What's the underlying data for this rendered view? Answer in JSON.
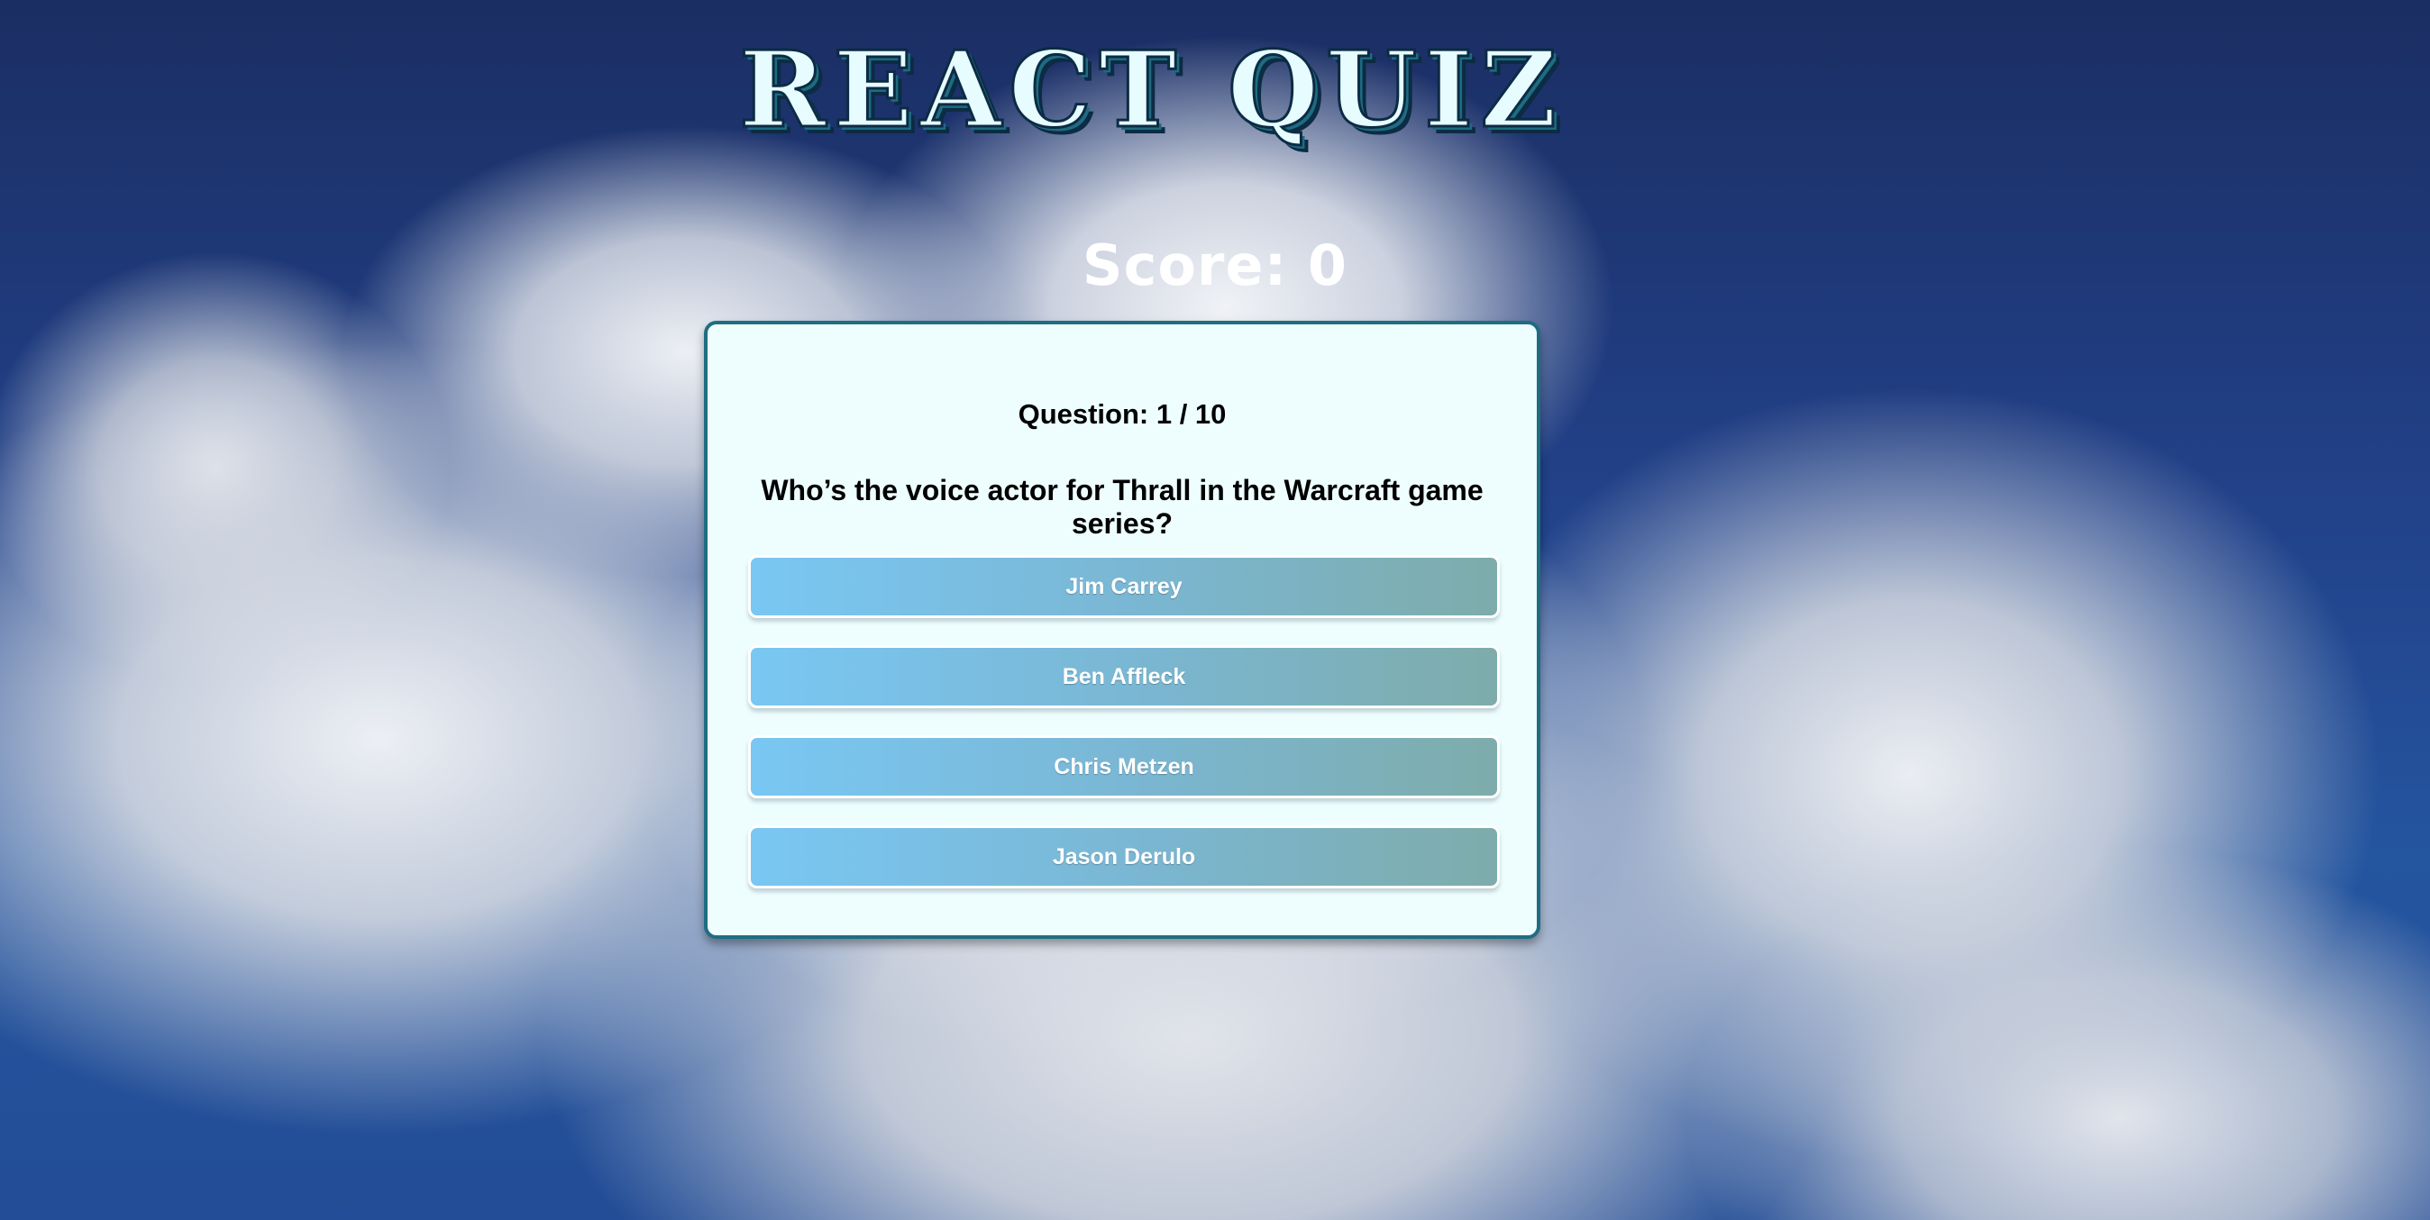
{
  "header": {
    "title": "REACT QUIZ"
  },
  "score": {
    "text": "Score: 0",
    "value": 0
  },
  "quiz": {
    "question_counter": "Question: 1 / 10",
    "question": "Who’s the voice actor for Thrall in the Warcraft game series?",
    "answers": [
      {
        "label": "Jim Carrey"
      },
      {
        "label": "Ben Affleck"
      },
      {
        "label": "Chris Metzen"
      },
      {
        "label": "Jason Derulo"
      }
    ]
  },
  "colors": {
    "card_background": "#eefeff",
    "card_border": "#1f6d82",
    "title_fill": "#e6fcff",
    "title_outline": "#0c2b44",
    "answer_gradient_start": "#79c7f3",
    "answer_gradient_end": "#7eacab",
    "sky": "#22428a"
  }
}
